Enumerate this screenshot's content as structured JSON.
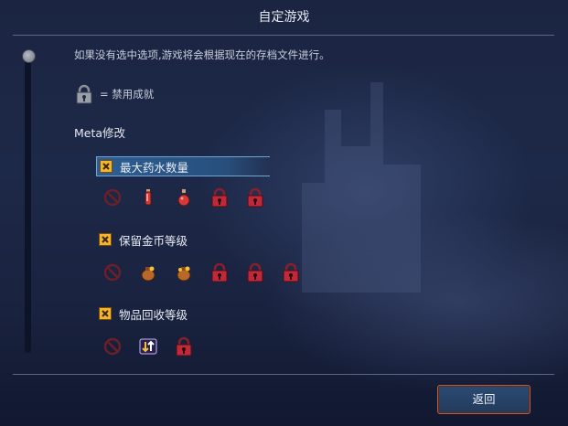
{
  "header": {
    "title": "自定游戏"
  },
  "info": {
    "text": "如果没有选中选项,游戏将会根据现在的存档文件进行。"
  },
  "legend": {
    "text": "= 禁用成就"
  },
  "section": {
    "title": "Meta修改"
  },
  "options": [
    {
      "label": "最大药水数量",
      "checked": true,
      "selected": true,
      "icons": [
        "disabled-icon",
        "potion-icon",
        "potion-flask-icon",
        "locked-icon",
        "locked-icon"
      ]
    },
    {
      "label": "保留金币等级",
      "checked": true,
      "selected": false,
      "icons": [
        "disabled-icon",
        "gold-sack-icon",
        "gold-sack-icon",
        "locked-icon",
        "locked-icon",
        "locked-icon"
      ]
    },
    {
      "label": "物品回收等级",
      "checked": true,
      "selected": false,
      "icons": [
        "disabled-icon",
        "recycle-icon",
        "locked-icon"
      ]
    }
  ],
  "footer": {
    "back_label": "返回"
  },
  "colors": {
    "checkbox": "#f2b431",
    "selected_row": "#2d5e93",
    "lock": "#c0293a",
    "button_border": "#b85b3a"
  }
}
